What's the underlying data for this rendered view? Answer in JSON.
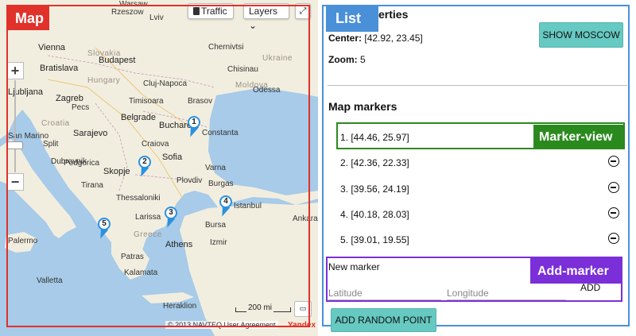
{
  "annotations": {
    "map_tag": "Map",
    "list_tag": "List",
    "marker_view_tag": "Marker-view",
    "add_marker_tag": "Add-marker"
  },
  "map": {
    "traffic_label": "Traffic",
    "layers_label": "Layers ⌄",
    "fullscreen_icon": "expand-icon",
    "zoom_in_label": "+",
    "zoom_out_label": "−",
    "scale_label": "200 mi",
    "copyright": "© 2013 NAVTEQ User Agreement",
    "brand": "Yandex",
    "countries": [
      "Slovakia",
      "Hungary",
      "Croatia",
      "Ukraine",
      "Moldova",
      "Greece"
    ],
    "cities": [
      "Rzeszow",
      "Lviv",
      "Warsaw",
      "Chernivtsi",
      "Vienna",
      "Bratislava",
      "Budapest",
      "Ljubljana",
      "Zagreb",
      "Timisoara",
      "Belgrade",
      "Sarajevo",
      "Bucharest",
      "Constanta",
      "Sofia",
      "Podgorica",
      "Skopje",
      "Tirana",
      "Thessaloniki",
      "Istanbul",
      "Athens",
      "Izmir",
      "Ankara",
      "Valletta",
      "Palermo",
      "San Marino",
      "Plovdiv",
      "Varna",
      "Craiova",
      "Brasov",
      "Chisinau",
      "Odessa",
      "Cluj-Napoca",
      "Pecs",
      "Split",
      "Dubrovnik",
      "Bursa",
      "Patras",
      "Heraklion",
      "Kalamata",
      "Larissa",
      "Burgas"
    ],
    "markers": [
      "1",
      "2",
      "3",
      "4",
      "5"
    ]
  },
  "panel": {
    "properties_title": "Map properties",
    "center_label": "Center:",
    "center_value": "[42.92, 23.45]",
    "zoom_label": "Zoom:",
    "zoom_value": "5",
    "show_moscow_label": "SHOW MOSCOW",
    "markers_title": "Map markers",
    "markers": [
      {
        "text": "1. [44.46, 25.97]"
      },
      {
        "text": "2. [42.36, 22.33]"
      },
      {
        "text": "3. [39.56, 24.19]"
      },
      {
        "text": "4. [40.18, 28.03]"
      },
      {
        "text": "5. [39.01, 19.55]"
      }
    ],
    "new_marker_label": "New marker",
    "latitude_placeholder": "Latitude",
    "longitude_placeholder": "Longitude",
    "add_label": "ADD",
    "random_point_label": "ADD RANDOM POINT"
  }
}
